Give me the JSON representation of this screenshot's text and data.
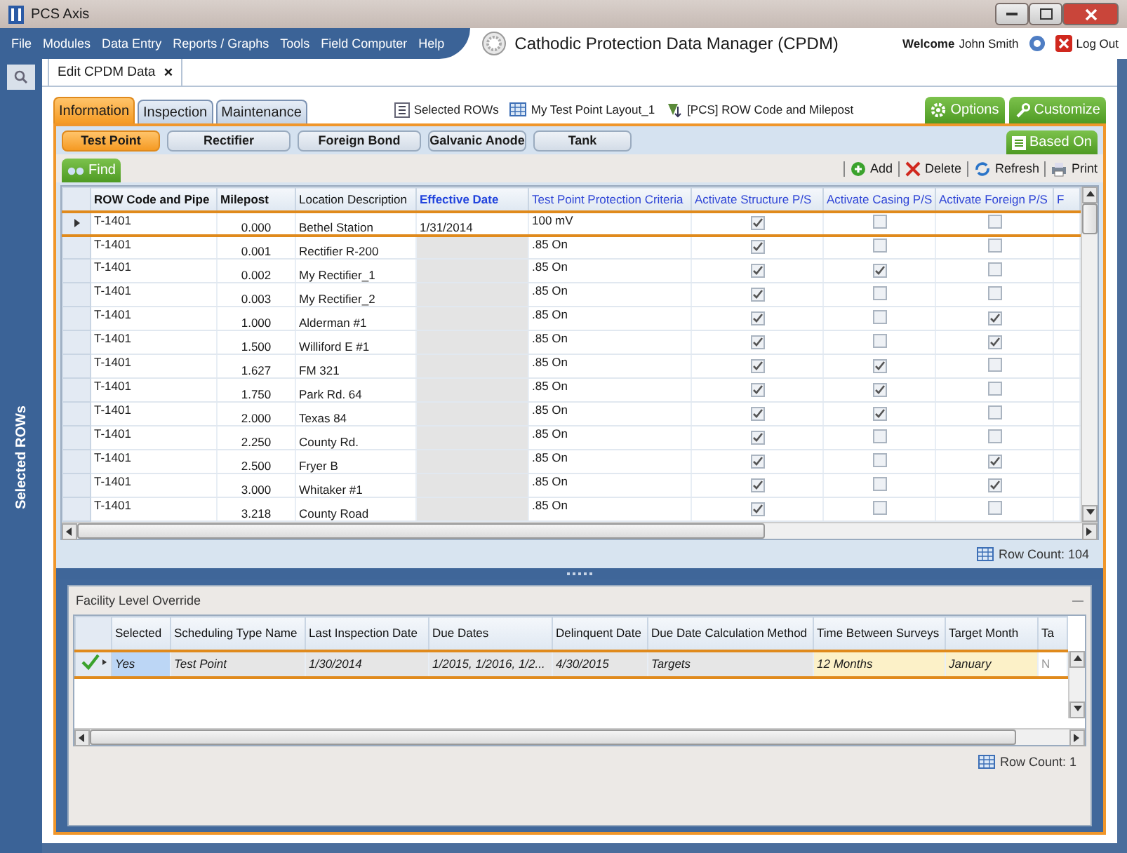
{
  "window": {
    "title": "PCS Axis"
  },
  "menu": [
    "File",
    "Modules",
    "Data Entry",
    "Reports / Graphs",
    "Tools",
    "Field Computer",
    "Help"
  ],
  "app_title": "Cathodic Protection Data Manager (CPDM)",
  "user": {
    "welcome": "Welcome",
    "name": "John Smith",
    "logout": "Log Out"
  },
  "sidebar": {
    "label": "Selected ROWs"
  },
  "document_tabs": [
    {
      "label": "Edit CPDM Data",
      "close": "×",
      "selected": true
    }
  ],
  "section_tabs": [
    {
      "label": "Information",
      "selected": true
    },
    {
      "label": "Inspection",
      "selected": false
    },
    {
      "label": "Maintenance",
      "selected": false
    }
  ],
  "info_links": [
    {
      "kind": "rows",
      "label": "Selected ROWs"
    },
    {
      "kind": "layout",
      "label": "My Test Point Layout_1"
    },
    {
      "kind": "sort",
      "label": "[PCS] ROW Code and Milepost"
    }
  ],
  "options_buttons": [
    {
      "kind": "options",
      "label": "Options"
    },
    {
      "kind": "customize",
      "label": "Customize"
    }
  ],
  "facility_tabs": [
    {
      "label": "Test Point",
      "selected": true
    },
    {
      "label": "Rectifier",
      "selected": false
    },
    {
      "label": "Foreign Bond",
      "selected": false
    },
    {
      "label": "Galvanic Anode",
      "selected": false
    },
    {
      "label": "Tank",
      "selected": false
    }
  ],
  "based_on": "Based On",
  "find": "Find",
  "toolbar": [
    {
      "kind": "add",
      "label": "Add"
    },
    {
      "kind": "delete",
      "label": "Delete"
    },
    {
      "kind": "refresh",
      "label": "Refresh"
    },
    {
      "kind": "print",
      "label": "Print"
    }
  ],
  "table": {
    "columns": [
      {
        "label": "ROW Code and Pipe",
        "kind": "key"
      },
      {
        "label": "Milepost",
        "kind": "key"
      },
      {
        "label": "Location Description",
        "kind": "plain"
      },
      {
        "label": "Effective Date",
        "kind": "required"
      },
      {
        "label": "Test Point Protection Criteria",
        "kind": "editable"
      },
      {
        "label": "Activate Structure P/S",
        "kind": "editable"
      },
      {
        "label": "Activate Casing P/S",
        "kind": "editable"
      },
      {
        "label": "Activate Foreign P/S",
        "kind": "editable"
      },
      {
        "label": "F",
        "kind": "editable"
      }
    ],
    "rows": [
      {
        "selected": true,
        "row": "T-1401",
        "milepost": "0.000",
        "location": "Bethel Station",
        "effective_date": "1/31/2014",
        "criteria": "100 mV",
        "structure": true,
        "casing": false,
        "foreign": false
      },
      {
        "selected": false,
        "row": "T-1401",
        "milepost": "0.001",
        "location": "Rectifier R-200",
        "criteria": ".85 On",
        "structure": true,
        "casing": false,
        "foreign": false
      },
      {
        "selected": false,
        "row": "T-1401",
        "milepost": "0.002",
        "location": "My Rectifier_1",
        "criteria": ".85 On",
        "structure": true,
        "casing": true,
        "foreign": false
      },
      {
        "selected": false,
        "row": "T-1401",
        "milepost": "0.003",
        "location": "My Rectifier_2",
        "criteria": ".85 On",
        "structure": true,
        "casing": false,
        "foreign": false
      },
      {
        "selected": false,
        "row": "T-1401",
        "milepost": "1.000",
        "location": "Alderman #1",
        "criteria": ".85 On",
        "structure": true,
        "casing": false,
        "foreign": true
      },
      {
        "selected": false,
        "row": "T-1401",
        "milepost": "1.500",
        "location": "Williford E #1",
        "criteria": ".85 On",
        "structure": true,
        "casing": false,
        "foreign": true
      },
      {
        "selected": false,
        "row": "T-1401",
        "milepost": "1.627",
        "location": "FM 321",
        "criteria": ".85 On",
        "structure": true,
        "casing": true,
        "foreign": false
      },
      {
        "selected": false,
        "row": "T-1401",
        "milepost": "1.750",
        "location": "Park Rd. 64",
        "criteria": ".85 On",
        "structure": true,
        "casing": true,
        "foreign": false
      },
      {
        "selected": false,
        "row": "T-1401",
        "milepost": "2.000",
        "location": "Texas 84",
        "criteria": ".85 On",
        "structure": true,
        "casing": true,
        "foreign": false
      },
      {
        "selected": false,
        "row": "T-1401",
        "milepost": "2.250",
        "location": "County Rd.",
        "criteria": ".85 On",
        "structure": true,
        "casing": false,
        "foreign": false
      },
      {
        "selected": false,
        "row": "T-1401",
        "milepost": "2.500",
        "location": "Fryer B",
        "criteria": ".85 On",
        "structure": true,
        "casing": false,
        "foreign": true
      },
      {
        "selected": false,
        "row": "T-1401",
        "milepost": "3.000",
        "location": "Whitaker #1",
        "criteria": ".85 On",
        "structure": true,
        "casing": false,
        "foreign": true
      },
      {
        "selected": false,
        "row": "T-1401",
        "milepost": "3.218",
        "location": "County Road",
        "criteria": ".85 On",
        "structure": true,
        "casing": false,
        "foreign": false
      }
    ],
    "row_count": "Row Count: 104"
  },
  "override": {
    "title": "Facility Level Override",
    "columns": [
      "Selected",
      "Scheduling Type Name",
      "Last Inspection Date",
      "Due Dates",
      "Delinquent Date",
      "Due Date Calculation Method",
      "Time Between Surveys",
      "Target Month",
      "Ta"
    ],
    "rows": [
      {
        "checked": true,
        "cells": [
          "Yes",
          "Test Point",
          "1/30/2014",
          "1/2015, 1/2016, 1/2...",
          "4/30/2015",
          "Targets",
          "12 Months",
          "January",
          "N"
        ]
      }
    ],
    "row_count": "Row Count: 1"
  }
}
